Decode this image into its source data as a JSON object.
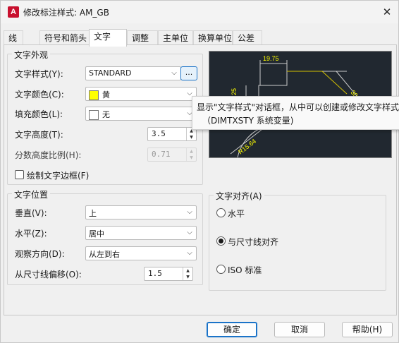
{
  "window": {
    "title": "修改标注样式: AM_GB",
    "app_icon_letter": "A"
  },
  "tabs": [
    {
      "label": "线"
    },
    {
      "label": "符号和箭头"
    },
    {
      "label": "文字"
    },
    {
      "label": "调整"
    },
    {
      "label": "主单位"
    },
    {
      "label": "换算单位"
    },
    {
      "label": "公差"
    }
  ],
  "active_tab": "文字",
  "appearance": {
    "title": "文字外观",
    "style_label": "文字样式(Y):",
    "style_value": "STANDARD",
    "style_button": "...",
    "color_label": "文字颜色(C):",
    "color_value": "黄",
    "color_swatch": "#ffff00",
    "fill_label": "填充颜色(L):",
    "fill_value": "无",
    "fill_swatch": "#ffffff",
    "height_label": "文字高度(T):",
    "height_value": "3.5",
    "fraction_label": "分数高度比例(H):",
    "fraction_value": "0.71",
    "frame_label": "绘制文字边框(F)",
    "frame_checked": false
  },
  "position": {
    "title": "文字位置",
    "vertical_label": "垂直(V):",
    "vertical_value": "上",
    "horizontal_label": "水平(Z):",
    "horizontal_value": "居中",
    "direction_label": "观察方向(D):",
    "direction_value": "从左到右",
    "offset_label": "从尺寸线偏移(O):",
    "offset_value": "1.5"
  },
  "alignment": {
    "title": "文字对齐(A)",
    "options": [
      {
        "label": "水平",
        "selected": false
      },
      {
        "label": "与尺寸线对齐",
        "selected": true
      },
      {
        "label": "ISO 标准",
        "selected": false
      }
    ]
  },
  "preview": {
    "dim_top": "19.75",
    "dim_left": "25",
    "dim_right": "30",
    "dim_radius": "R15.64"
  },
  "tooltip": {
    "line1": "显示\"文字样式\"对话框，从中可以创建或修改文字样式",
    "line2": "（DIMTXSTY 系统变量)"
  },
  "buttons": {
    "ok": "确定",
    "cancel": "取消",
    "help": "帮助(H)"
  },
  "icons": {
    "close": "close-icon",
    "dropdown": "chevron-down-icon"
  }
}
